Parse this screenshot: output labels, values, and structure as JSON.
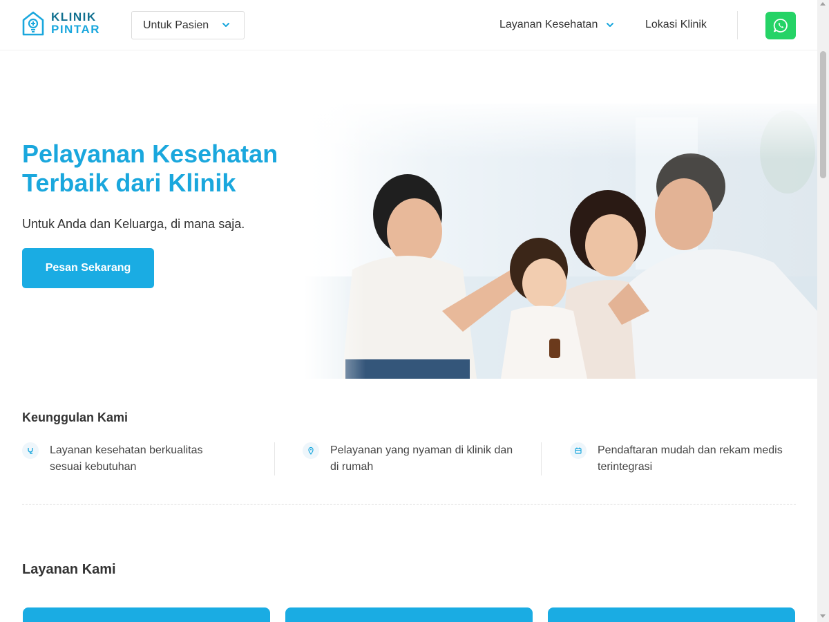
{
  "header": {
    "logo": {
      "line1": "KLINIK",
      "line2": "PINTAR"
    },
    "patient_select": {
      "value": "Untuk Pasien"
    },
    "nav": [
      {
        "label": "Layanan Kesehatan"
      },
      {
        "label": "Lokasi Klinik"
      }
    ],
    "whatsapp_icon": "whatsapp-icon"
  },
  "hero": {
    "title_line1": "Pelayanan Kesehatan",
    "title_line2": "Terbaik dari Klinik",
    "subtitle": "Untuk Anda dan Keluarga, di mana saja.",
    "cta_label": "Pesan Sekarang"
  },
  "advantages": {
    "title": "Keunggulan Kami",
    "items": [
      {
        "icon": "stethoscope-icon",
        "text": "Layanan kesehatan berkualitas sesuai kebutuhan"
      },
      {
        "icon": "location-pin-icon",
        "text": "Pelayanan yang nyaman di klinik dan di rumah"
      },
      {
        "icon": "calendar-icon",
        "text": "Pendaftaran mudah dan rekam medis terintegrasi"
      }
    ]
  },
  "services": {
    "title": "Layanan Kami"
  },
  "colors": {
    "brand": "#1aa7dd",
    "brand_dark": "#0f6f8f",
    "whatsapp": "#25d366",
    "cta": "#1aace3"
  }
}
